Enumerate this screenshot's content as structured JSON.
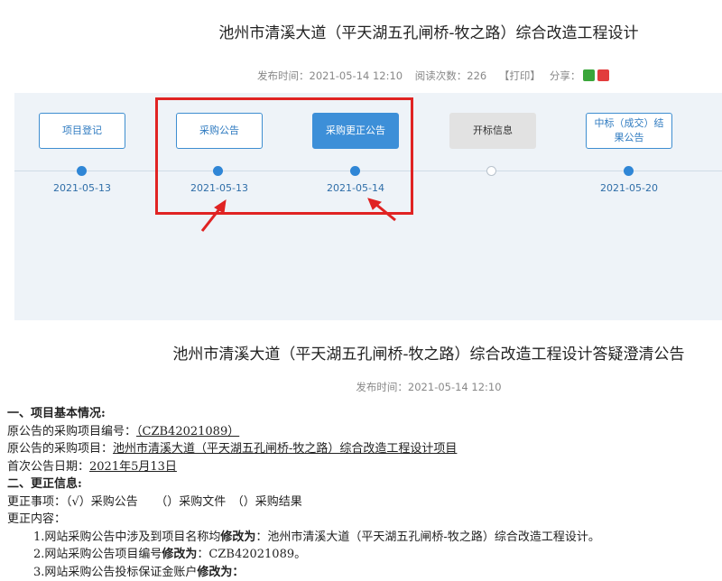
{
  "header": {
    "title": "池州市清溪大道（平天湖五孔闸桥-牧之路）综合改造工程设计",
    "publish_time": "发布时间：2021-05-14 12:10",
    "read_count": "阅读次数：226",
    "print_label": "【打印】",
    "share_label": "分享：",
    "share_icons": [
      "wechat-icon",
      "weibo-icon"
    ]
  },
  "timeline": {
    "steps": [
      {
        "label": "项目登记",
        "date": "2021-05-13",
        "state": "done"
      },
      {
        "label": "采购公告",
        "date": "2021-05-13",
        "state": "done"
      },
      {
        "label": "采购更正公告",
        "date": "2021-05-14",
        "state": "active"
      },
      {
        "label": "开标信息",
        "date": "",
        "state": "pending"
      },
      {
        "label": "中标（成交）结果公告",
        "date": "2021-05-20",
        "state": "done"
      }
    ],
    "highlight_color": "#e02323",
    "accent_color": "#3d8fd8"
  },
  "notice": {
    "title": "池州市清溪大道（平天湖五孔闸桥-牧之路）综合改造工程设计答疑澄清公告",
    "publish_time": "发布时间：2021-05-14 12:10",
    "section1_heading": "一、项目基本情况:",
    "orig_no_label": "原公告的采购项目编号：",
    "orig_no_value": "（CZB42021089）",
    "orig_project_label": "原公告的采购项目：",
    "orig_project_value": "池州市清溪大道（平天湖五孔闸桥-牧之路）综合改造工程设计项目",
    "first_date_label": "首次公告日期：",
    "first_date_value": "2021年5月13日",
    "section2_heading": "二、更正信息:",
    "change_items": "更正事项：（√）采购公告　　（）采购文件　（）采购结果",
    "change_content_label": "更正内容：",
    "items": [
      {
        "prefix": "1.网站采购公告中涉及到项目名称均",
        "bold": "修改为",
        "suffix": "：池州市清溪大道（平天湖五孔闸桥-牧之路）综合改造工程设计。"
      },
      {
        "prefix": "2.网站采购公告项目编号",
        "bold": "修改为",
        "suffix": "：CZB42021089。"
      },
      {
        "prefix": "3.网站采购公告投标保证金账户",
        "bold": "修改为",
        "suffix": "："
      }
    ]
  }
}
